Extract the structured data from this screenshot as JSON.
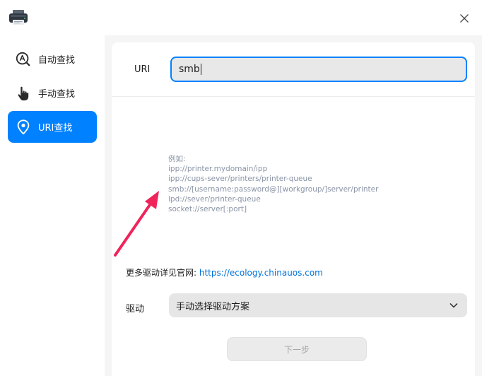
{
  "window": {
    "app_icon": "printer-icon",
    "close_icon": "close-icon"
  },
  "sidebar": {
    "items": [
      {
        "label": "自动查找",
        "icon": "auto-search-icon",
        "active": false
      },
      {
        "label": "手动查找",
        "icon": "hand-pointer-icon",
        "active": false
      },
      {
        "label": "URI查找",
        "icon": "location-pin-icon",
        "active": true
      }
    ]
  },
  "uri": {
    "label": "URI",
    "value": "smb"
  },
  "examples": {
    "heading": "例如:",
    "lines": [
      "ipp://printer.mydomain/ipp",
      "ipp://cups-sever/printers/printer-queue",
      "smb://[username:password@][workgroup/]server/printer",
      "lpd://sever/printer-queue",
      "socket://server[:port]"
    ]
  },
  "more_drivers": {
    "text": "更多驱动详见官网:",
    "link": "https://ecology.chinauos.com"
  },
  "driver": {
    "label": "驱动",
    "selected": "手动选择驱动方案"
  },
  "next_button": {
    "label": "下一步",
    "enabled": false
  },
  "colors": {
    "accent": "#0081ff",
    "annotation_arrow": "#f0245a",
    "example_text": "#8a94a6",
    "link": "#0072d9"
  }
}
